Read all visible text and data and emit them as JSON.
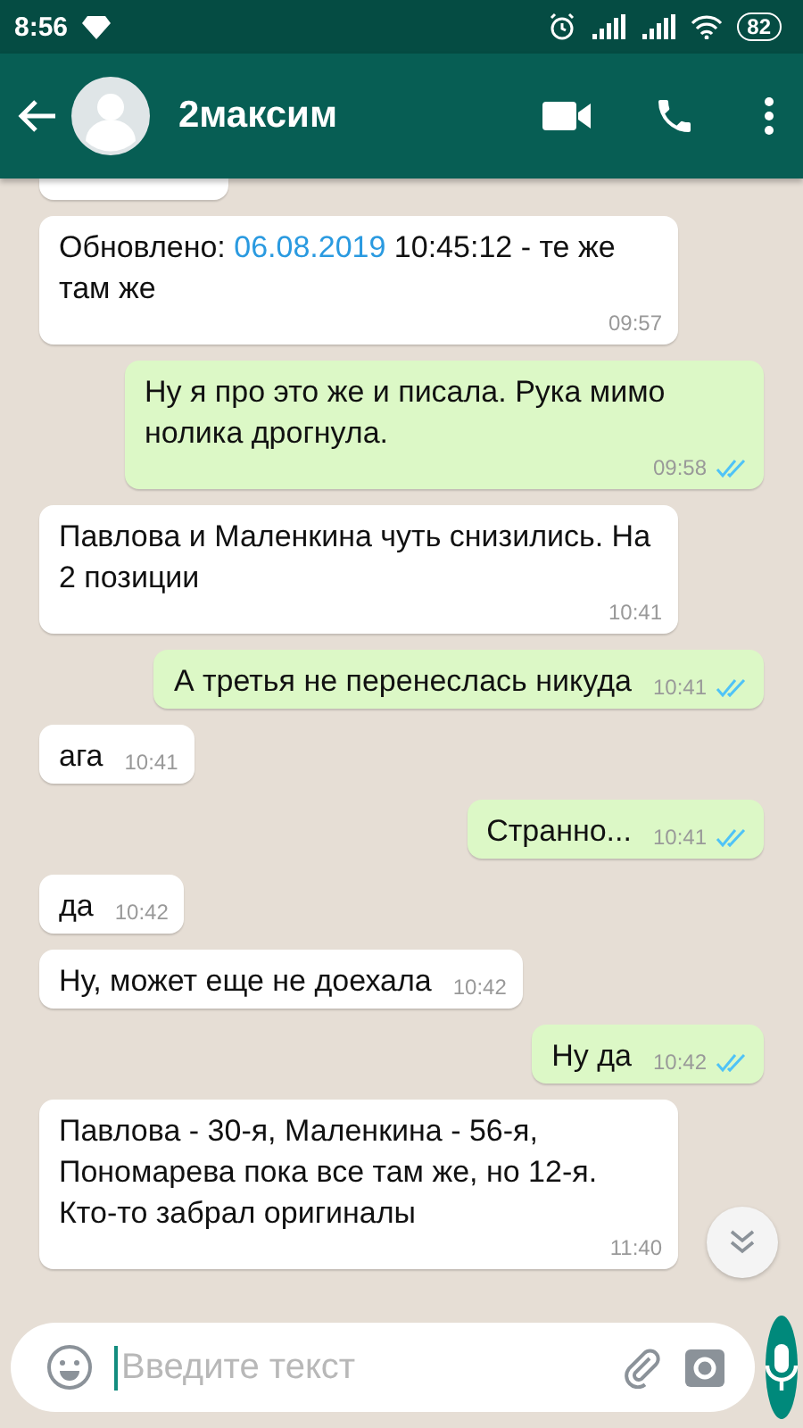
{
  "status_bar": {
    "time": "8:56",
    "battery": "82"
  },
  "header": {
    "contact_name": "2максим"
  },
  "messages": [
    {
      "kind": "partial"
    },
    {
      "kind": "incoming",
      "parts": [
        {
          "text": "Обновлено: "
        },
        {
          "text": "06.08.2019",
          "kind": "link"
        },
        {
          "text": " 10:45:12 - те же там же"
        }
      ],
      "time": "09:57"
    },
    {
      "kind": "outgoing",
      "parts": [
        {
          "text": "Ну я про это же и писала. Рука мимо нолика дрогнула."
        }
      ],
      "time": "09:58",
      "read": true
    },
    {
      "kind": "incoming",
      "parts": [
        {
          "text": "Павлова и Маленкина чуть снизились. На 2 позиции"
        }
      ],
      "time": "10:41"
    },
    {
      "kind": "outgoing",
      "parts": [
        {
          "text": "А третья не перенеслась никуда"
        }
      ],
      "time": "10:41",
      "read": true
    },
    {
      "kind": "incoming",
      "parts": [
        {
          "text": "ага"
        }
      ],
      "time": "10:41"
    },
    {
      "kind": "outgoing",
      "parts": [
        {
          "text": "Странно..."
        }
      ],
      "time": "10:41",
      "read": true
    },
    {
      "kind": "incoming",
      "parts": [
        {
          "text": "да"
        }
      ],
      "time": "10:42"
    },
    {
      "kind": "incoming",
      "parts": [
        {
          "text": "Ну, может еще не доехала"
        }
      ],
      "time": "10:42"
    },
    {
      "kind": "outgoing",
      "parts": [
        {
          "text": "Ну да"
        }
      ],
      "time": "10:42",
      "read": true
    },
    {
      "kind": "incoming",
      "parts": [
        {
          "text": "Павлова - 30-я, Маленкина - 56-я, Пономарева пока все там же, но 12-я. Кто-то забрал оригиналы"
        }
      ],
      "time": "11:40"
    }
  ],
  "composer": {
    "placeholder": "Введите текст"
  }
}
